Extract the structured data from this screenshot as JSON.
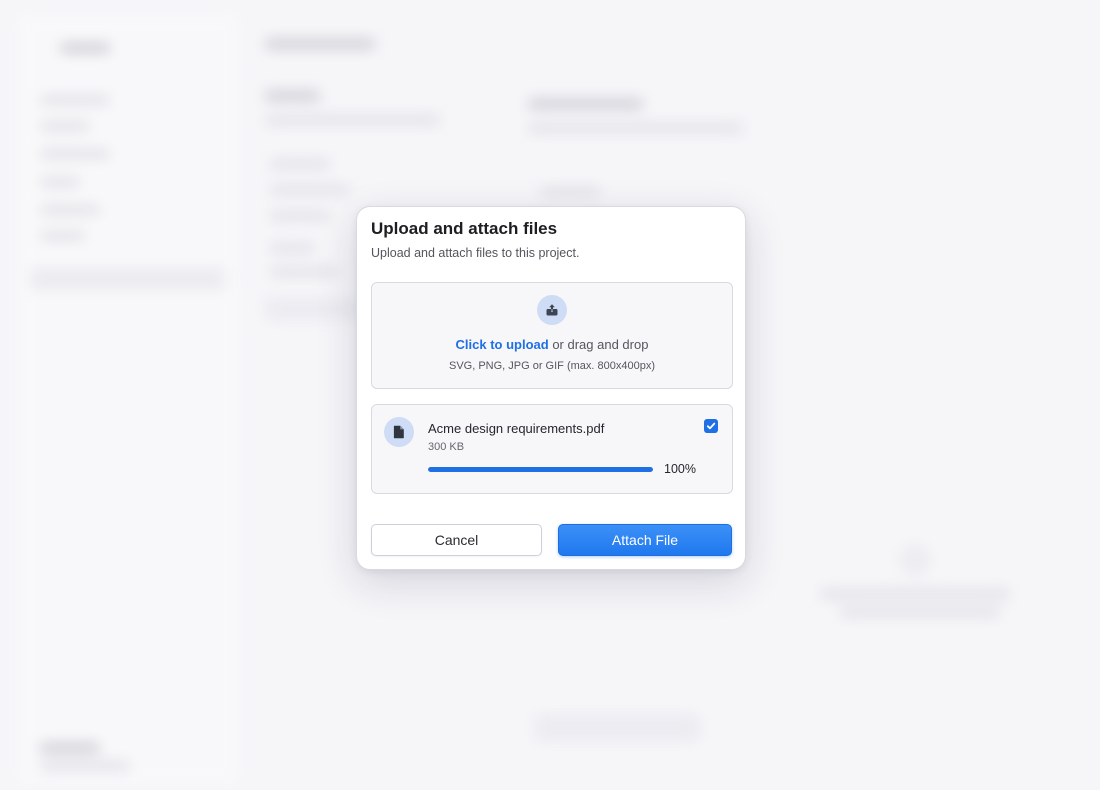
{
  "modal": {
    "title": "Upload and attach files",
    "subtitle": "Upload and attach files to this project.",
    "dropzone": {
      "icon": "upload-icon",
      "link_text": "Click to upload",
      "rest_text": "or drag and drop",
      "hint": "SVG, PNG, JPG or GIF (max. 800x400px)"
    },
    "file": {
      "icon": "document-icon",
      "name": "Acme design requirements.pdf",
      "size": "300 KB",
      "progress": 1.0,
      "progress_label": "100%",
      "checked": true
    },
    "buttons": {
      "cancel": "Cancel",
      "attach": "Attach File"
    }
  },
  "colors": {
    "accent": "#1f6fe5",
    "icon_bg": "#cfdcf5"
  }
}
